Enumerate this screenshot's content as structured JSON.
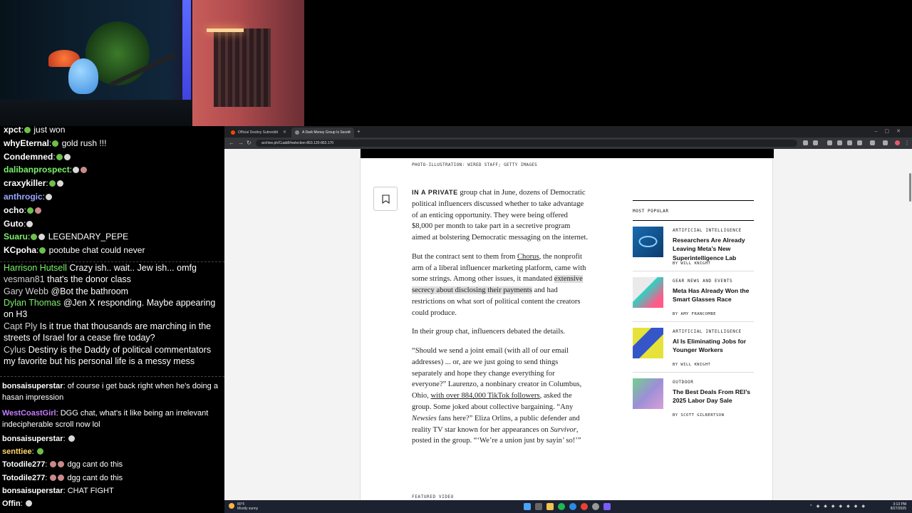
{
  "chat": {
    "top_lines": [
      {
        "user": "xpct",
        "color": "#ffffff",
        "text": " just won",
        "emotes": [
          "g"
        ]
      },
      {
        "user": "whyEternal",
        "color": "#ffffff",
        "text": " gold rush !!!",
        "emotes": [
          "g"
        ]
      },
      {
        "user": "Condemned",
        "color": "#ffffff",
        "text": "",
        "emotes": [
          "g",
          "w"
        ]
      },
      {
        "user": "dalibanprospect",
        "color": "#7cf06b",
        "text": "",
        "emotes": [
          "w",
          "s"
        ]
      },
      {
        "user": "craxykiller",
        "color": "#ffffff",
        "text": "",
        "emotes": [
          "g",
          "w"
        ]
      },
      {
        "user": "anthrogic",
        "color": "#9aa8ff",
        "text": "",
        "emotes": [
          "w"
        ]
      },
      {
        "user": "ocho",
        "color": "#ffffff",
        "text": "",
        "emotes": [
          "g",
          "s"
        ]
      },
      {
        "user": "Guto",
        "color": "#ffffff",
        "text": "",
        "emotes": [
          "w"
        ]
      },
      {
        "user": "Suaru",
        "color": "#7cf06b",
        "text": " LEGENDARY_PEPE",
        "emotes": [
          "g",
          "w"
        ]
      },
      {
        "user": "KCpoha",
        "color": "#ffffff",
        "text": " pootube chat could never",
        "emotes": [
          "g"
        ]
      }
    ],
    "mid_lines": [
      {
        "user": "Harrison Hutsell",
        "color": "#7cf06b",
        "text": " Crazy ish.. wait.. Jew ish... omfg"
      },
      {
        "user": "vesman81",
        "color": "#cfcfcf",
        "text": " that's the donor class"
      },
      {
        "user": "Gary Webb",
        "color": "#cfcfcf",
        "text": " @Bot the bathroom"
      },
      {
        "user": "Dylan Thomas",
        "color": "#7cf06b",
        "text": " @Jen X responding. Maybe appearing on H3"
      },
      {
        "user": "Capt Ply",
        "color": "#cfcfcf",
        "text": " Is it true that thousands are marching in the streets of Israel for a cease fire today?"
      },
      {
        "user": "Cylus",
        "color": "#cfcfcf",
        "text": " Destiny is the Daddy of political commentators my favorite but his personal life is a messy mess"
      }
    ],
    "bottom_lines": [
      {
        "user": "bonsaisuperstar",
        "color": "#ffffff",
        "text": " of course i get back right when he's doing a hasan impression"
      },
      {
        "user": "WestCoastGirl",
        "color": "#c77dff",
        "text": " DGG chat, what's it like being an irrelevant indecipherable scroll now lol"
      },
      {
        "user": "bonsaisuperstar",
        "color": "#ffffff",
        "text": ""
      },
      {
        "user": "senttiee",
        "color": "#ffd76b",
        "text": ""
      },
      {
        "user": "Totodile277",
        "color": "#ffffff",
        "text": " dgg cant do this"
      },
      {
        "user": "Totodile277",
        "color": "#ffffff",
        "text": " dgg cant do this"
      },
      {
        "user": "bonsaisuperstar",
        "color": "#ffffff",
        "text": " CHAT FIGHT"
      },
      {
        "user": "Offin",
        "color": "#ffffff",
        "text": ""
      }
    ]
  },
  "browser": {
    "tabs": [
      {
        "label": "Official Destiny Subreddit",
        "active": false
      },
      {
        "label": "A Dark Money Group Is Secret",
        "active": true
      }
    ],
    "url": "archive.ph/Cuab8#selection-863.120-863.170"
  },
  "article": {
    "photo_credit": "PHOTO-ILLUSTRATION: WIRED STAFF; GETTY IMAGES",
    "p1_lead": "IN A PRIVATE",
    "p1_rest": " group chat in June, dozens of Democratic political influencers discussed whether to take advantage of an enticing opportunity. They were being offered $8,000 per month to take part in a secretive program aimed at bolstering Democratic messaging on the internet.",
    "p2_a": "But the contract sent to them from ",
    "p2_link": "Chorus",
    "p2_b": ", the nonprofit arm of a liberal influencer marketing platform, came with some strings. Among other issues, it mandated ",
    "p2_hl": "extensive secrecy about disclosing their payments",
    "p2_c": " and had restrictions on what sort of political content the creators could produce.",
    "p3": "In their group chat, influencers debated the details.",
    "p4_a": "“Should we send a joint email (with all of our email addresses) ... or, are we just going to send things separately and hope they change everything for everyone?” Laurenzo, a nonbinary creator in Columbus, Ohio, ",
    "p4_link": "with over 884,000 TikTok followers",
    "p4_b": ", asked the group. Some joked about collective bargaining. “Any ",
    "p4_i1": "Newsies",
    "p4_c": " fans here?” Eliza Orlins, a public defender and reality TV star known for her appearances on ",
    "p4_i2": "Survivor",
    "p4_d": ", posted in the group. “‘We’re a union just by sayin’ so!’”",
    "featured": "FEATURED VIDEO"
  },
  "most_popular": {
    "heading": "MOST POPULAR",
    "items": [
      {
        "category": "ARTIFICIAL INTELLIGENCE",
        "title": "Researchers Are Already Leaving Meta’s New Superintelligence Lab",
        "byline": "BY WILL KNIGHT",
        "thumb": "#1a6bb0"
      },
      {
        "category": "GEAR NEWS AND EVENTS",
        "title": "Meta Has Already Won the Smart Glasses Race",
        "byline": "BY AMY FRANCOMBE",
        "thumb": "#2bd3c4"
      },
      {
        "category": "ARTIFICIAL INTELLIGENCE",
        "title": "AI Is Eliminating Jobs for Younger Workers",
        "byline": "BY WILL KNIGHT",
        "thumb": "#e6e23a"
      },
      {
        "category": "OUTDOOR",
        "title": "The Best Deals From REI’s 2025 Labor Day Sale",
        "byline": "BY SCOTT GILBERTSON",
        "thumb": "#9c8fd6"
      }
    ]
  },
  "taskbar": {
    "weather_temp": "80°F",
    "weather_desc": "Mostly sunny",
    "time": "3:13 PM",
    "date": "8/27/2025"
  }
}
